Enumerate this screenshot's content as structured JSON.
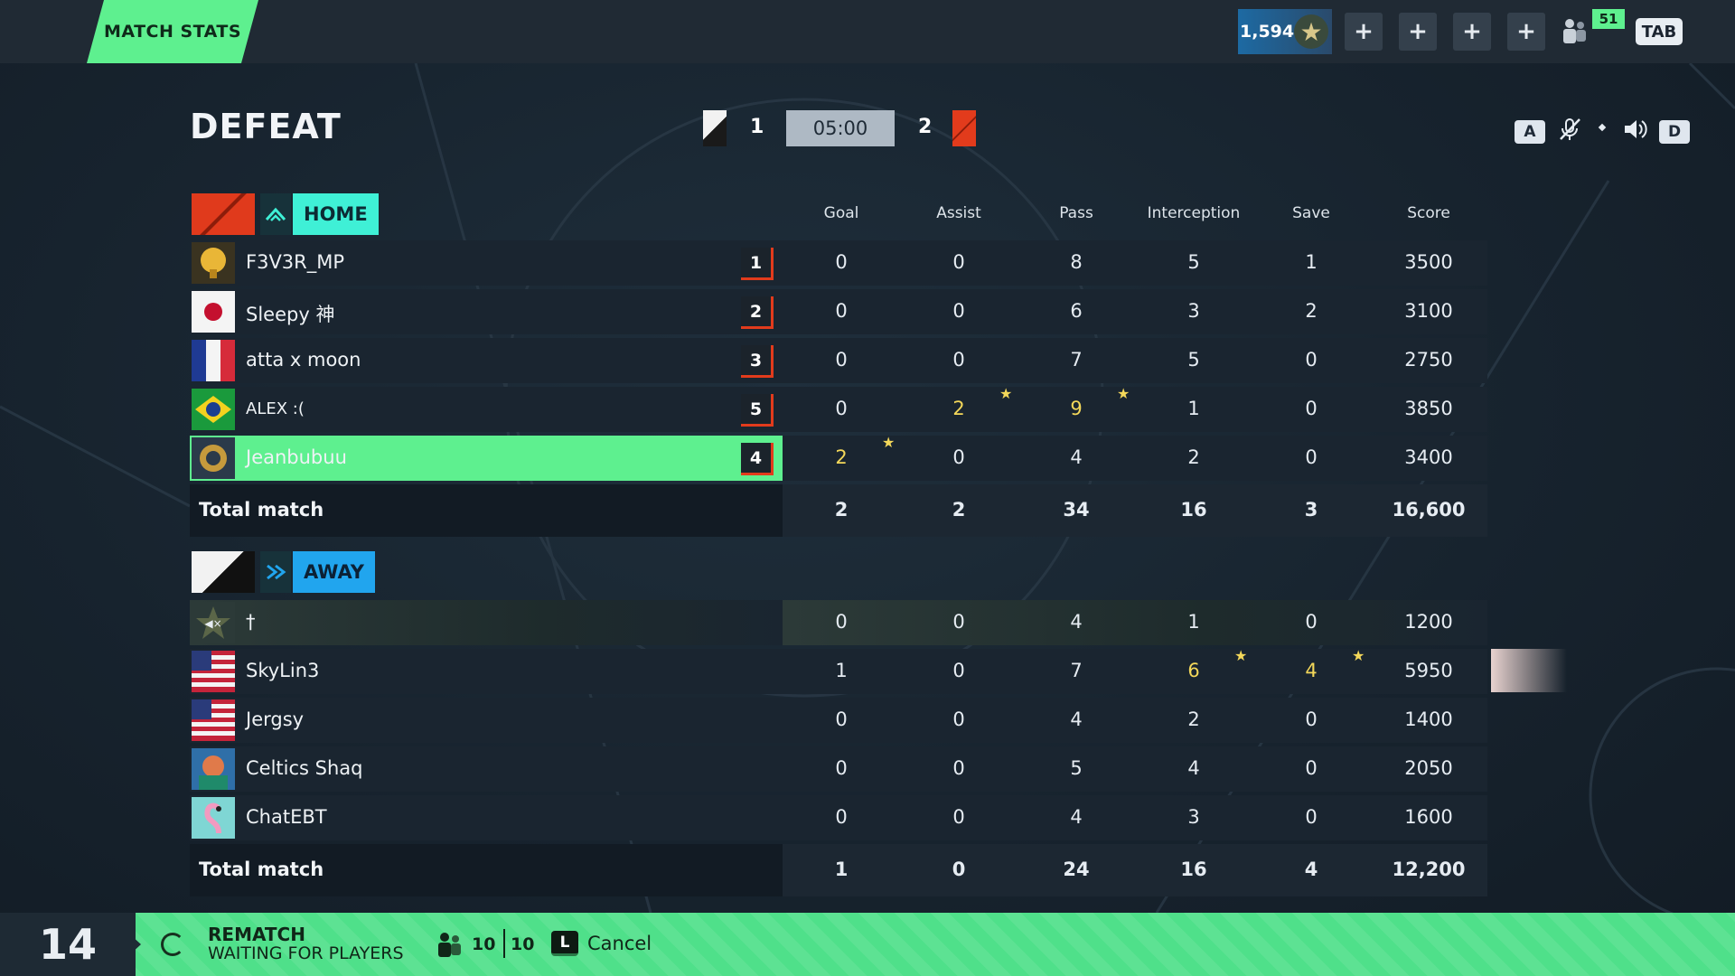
{
  "topbar": {
    "title": "MATCH STATS",
    "currency": "1,594",
    "friends_count": "51",
    "tab_key": "TAB"
  },
  "header": {
    "result": "DEFEAT",
    "home_score": "1",
    "timer": "05:00",
    "away_score": "2",
    "key_left": "A",
    "key_right": "D"
  },
  "columns": [
    "Goal",
    "Assist",
    "Pass",
    "Interception",
    "Save",
    "Score"
  ],
  "home": {
    "team_name": "HOME",
    "players": [
      {
        "name": "F3V3R_MP",
        "rank": "1",
        "stats": [
          "0",
          "0",
          "8",
          "5",
          "1",
          "3500"
        ]
      },
      {
        "name": "Sleepy 神",
        "rank": "2",
        "stats": [
          "0",
          "0",
          "6",
          "3",
          "2",
          "3100"
        ]
      },
      {
        "name": "atta x moon",
        "rank": "3",
        "stats": [
          "0",
          "0",
          "7",
          "5",
          "0",
          "2750"
        ]
      },
      {
        "name": "ALEX :(",
        "rank": "5",
        "stats": [
          "0",
          "2",
          "9",
          "1",
          "0",
          "3850"
        ]
      },
      {
        "name": "Jeanbubuu",
        "rank": "4",
        "stats": [
          "2",
          "0",
          "4",
          "2",
          "0",
          "3400"
        ]
      }
    ],
    "total_label": "Total match",
    "totals": [
      "2",
      "2",
      "34",
      "16",
      "3",
      "16,600"
    ]
  },
  "away": {
    "team_name": "AWAY",
    "players": [
      {
        "name": "†",
        "stats": [
          "0",
          "0",
          "4",
          "1",
          "0",
          "1200"
        ]
      },
      {
        "name": "SkyLin3",
        "stats": [
          "1",
          "0",
          "7",
          "6",
          "4",
          "5950"
        ]
      },
      {
        "name": "Jergsy",
        "stats": [
          "0",
          "0",
          "4",
          "2",
          "0",
          "1400"
        ]
      },
      {
        "name": "Celtics Shaq",
        "stats": [
          "0",
          "0",
          "5",
          "4",
          "0",
          "2050"
        ]
      },
      {
        "name": "ChatEBT",
        "stats": [
          "0",
          "0",
          "4",
          "3",
          "0",
          "1600"
        ]
      }
    ],
    "total_label": "Total match",
    "totals": [
      "1",
      "0",
      "24",
      "16",
      "4",
      "12,200"
    ]
  },
  "bottom": {
    "countdown": "14",
    "rematch_title": "REMATCH",
    "rematch_status": "WAITING FOR PLAYERS",
    "players_ready": "10",
    "players_total": "10",
    "cancel_key": "L",
    "cancel_label": "Cancel"
  },
  "colors": {
    "accent_green": "#5ef08f",
    "home_red": "#e23b1c",
    "home_cyan": "#3ff0d6",
    "away_blue": "#21a5ee",
    "mvp_gold": "#f4d85a",
    "me_outline": "#e7d34b"
  }
}
